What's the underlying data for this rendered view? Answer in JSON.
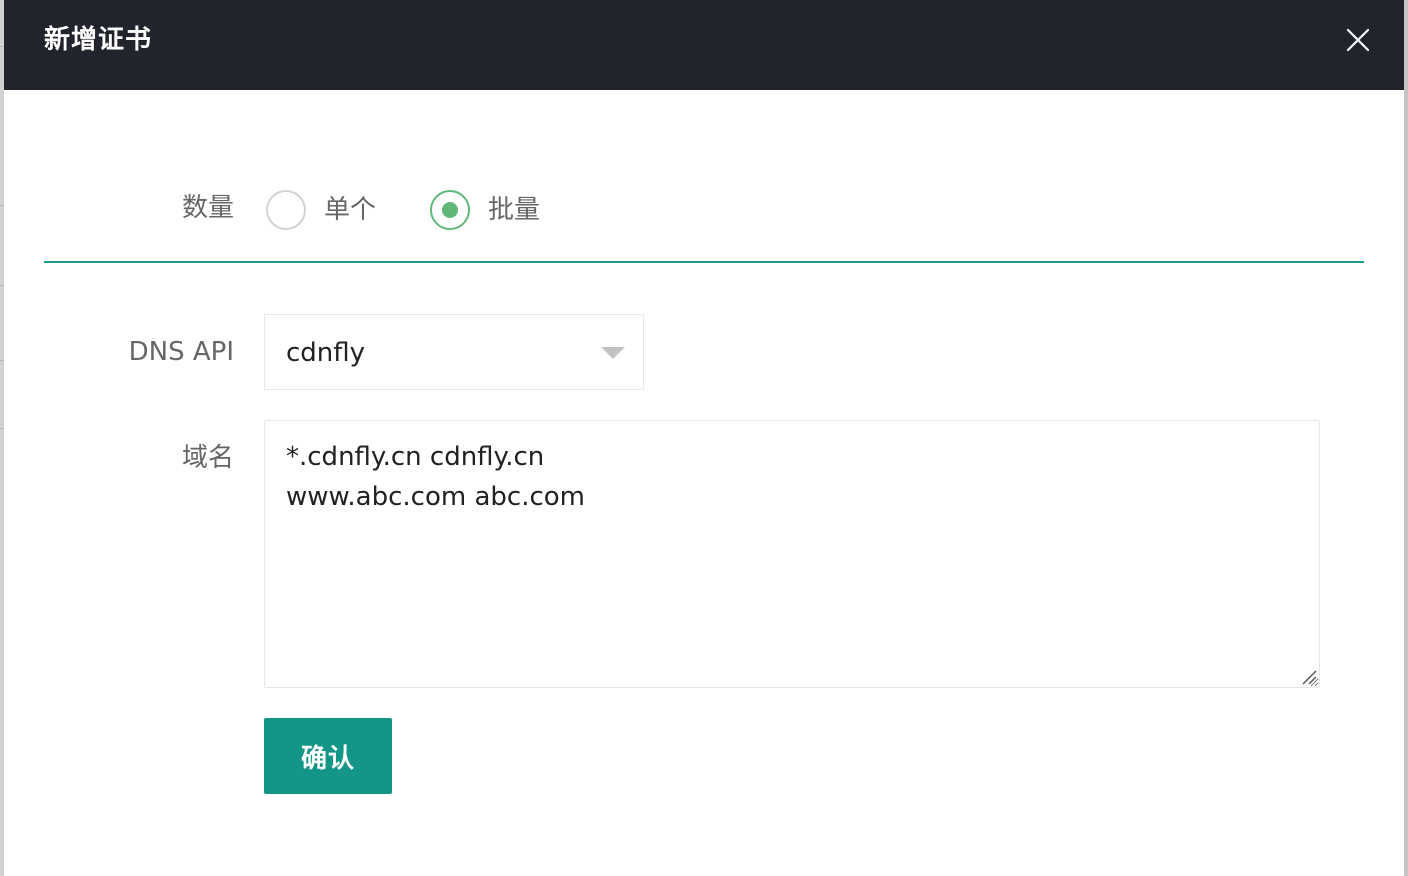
{
  "dialog": {
    "title": "新增证书",
    "close_icon": "close-icon"
  },
  "form": {
    "quantity": {
      "label": "数量",
      "options": [
        {
          "label": "单个",
          "checked": false
        },
        {
          "label": "批量",
          "checked": true
        }
      ]
    },
    "dns_api": {
      "label": "DNS API",
      "selected": "cdnfly"
    },
    "domain": {
      "label": "域名",
      "value": "*.cdnfly.cn cdnfly.cn\nwww.abc.com abc.com"
    },
    "submit_label": "确认"
  },
  "colors": {
    "header_bg": "#21242c",
    "accent": "#139688",
    "radio_checked": "#5fb878",
    "divider": "#1e9a8e"
  }
}
